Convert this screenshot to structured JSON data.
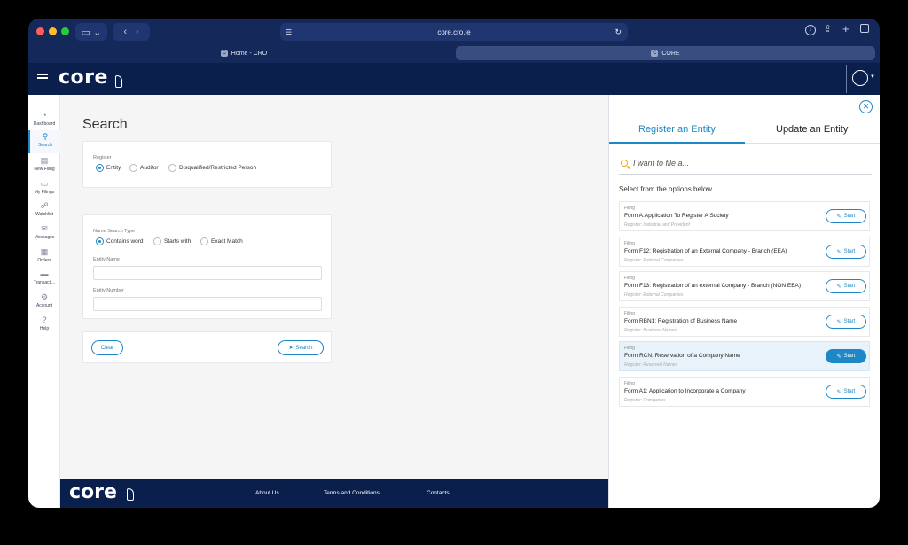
{
  "browser": {
    "url": "core.cro.ie",
    "tabs": [
      {
        "label": "Home - CRO",
        "active": false
      },
      {
        "label": "CORE",
        "active": true
      }
    ]
  },
  "app": {
    "logo": "core"
  },
  "sidebar": {
    "items": [
      {
        "label": "Dashboard",
        "icon": "dashboard-icon",
        "active": false
      },
      {
        "label": "Search",
        "icon": "search-icon",
        "active": true
      },
      {
        "label": "New Filing",
        "icon": "new-filing-icon",
        "active": false
      },
      {
        "label": "My Filings",
        "icon": "folder-icon",
        "active": false
      },
      {
        "label": "Watchlist",
        "icon": "watchlist-icon",
        "active": false
      },
      {
        "label": "Messages",
        "icon": "mail-icon",
        "active": false
      },
      {
        "label": "Orders",
        "icon": "orders-icon",
        "active": false
      },
      {
        "label": "Transacti...",
        "icon": "card-icon",
        "active": false
      },
      {
        "label": "Account",
        "icon": "gear-icon",
        "active": false
      },
      {
        "label": "Help",
        "icon": "help-icon",
        "active": false
      }
    ]
  },
  "search": {
    "title": "Search",
    "register_label": "Register",
    "register_options": [
      "Entity",
      "Auditor",
      "Disqualified/Restricted Person"
    ],
    "register_selected": "Entity",
    "name_search_type_label": "Name Search Type",
    "name_search_options": [
      "Contains word",
      "Starts with",
      "Exact Match"
    ],
    "name_search_selected": "Contains word",
    "entity_name_label": "Entity Name",
    "entity_number_label": "Entity Number",
    "clear_label": "Clear",
    "search_label": "Search"
  },
  "footer": {
    "logo": "core",
    "links": [
      "About Us",
      "Terms and Conditions",
      "Contacts"
    ]
  },
  "panel": {
    "tabs": [
      {
        "label": "Register an Entity",
        "active": true
      },
      {
        "label": "Update an Entity",
        "active": false
      }
    ],
    "search_placeholder": "I want to file a...",
    "select_text": "Select from the options below",
    "filings": [
      {
        "kind": "Filing",
        "name": "Form A:Application To Register A Society",
        "register": "Register: Industrial and Provident",
        "start": "Start",
        "highlighted": false
      },
      {
        "kind": "Filing",
        "name": "Form F12: Registration of an External Company - Branch (EEA)",
        "register": "Register: External Companies",
        "start": "Start",
        "highlighted": false
      },
      {
        "kind": "Filing",
        "name": "Form F13: Registration of an external Company - Branch (NON EEA)",
        "register": "Register: External Companies",
        "start": "Start",
        "highlighted": false
      },
      {
        "kind": "Filing",
        "name": "Form RBN1: Registration of Business Name",
        "register": "Register: Business Names",
        "start": "Start",
        "highlighted": false
      },
      {
        "kind": "Filing",
        "name": "Form RCN: Reservation of a Company Name",
        "register": "Register: Reserved Names",
        "start": "Start",
        "highlighted": true
      },
      {
        "kind": "Filing",
        "name": "Form A1: Application to Incorporate a Company",
        "register": "Register: Companies",
        "start": "Start",
        "highlighted": false
      }
    ]
  },
  "colors": {
    "navy": "#0b1f4d",
    "accent": "#1e88c6",
    "search_icon": "#f0a800"
  }
}
